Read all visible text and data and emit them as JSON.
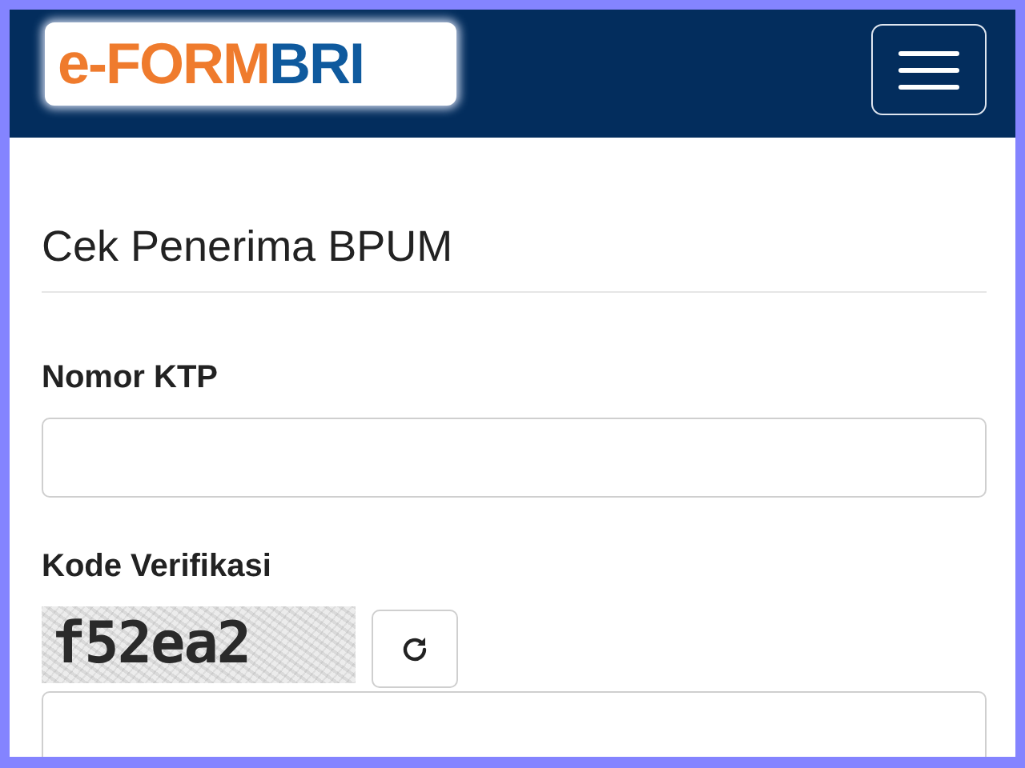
{
  "navbar": {
    "logo": {
      "primary": "e-FORM",
      "secondary": "BRI"
    }
  },
  "form": {
    "title": "Cek Penerima BPUM",
    "fields": [
      {
        "kind": "text",
        "label": "Nomor KTP"
      },
      {
        "kind": "captcha",
        "label": "Kode Verifikasi",
        "captcha": "f52ea2"
      }
    ]
  }
}
